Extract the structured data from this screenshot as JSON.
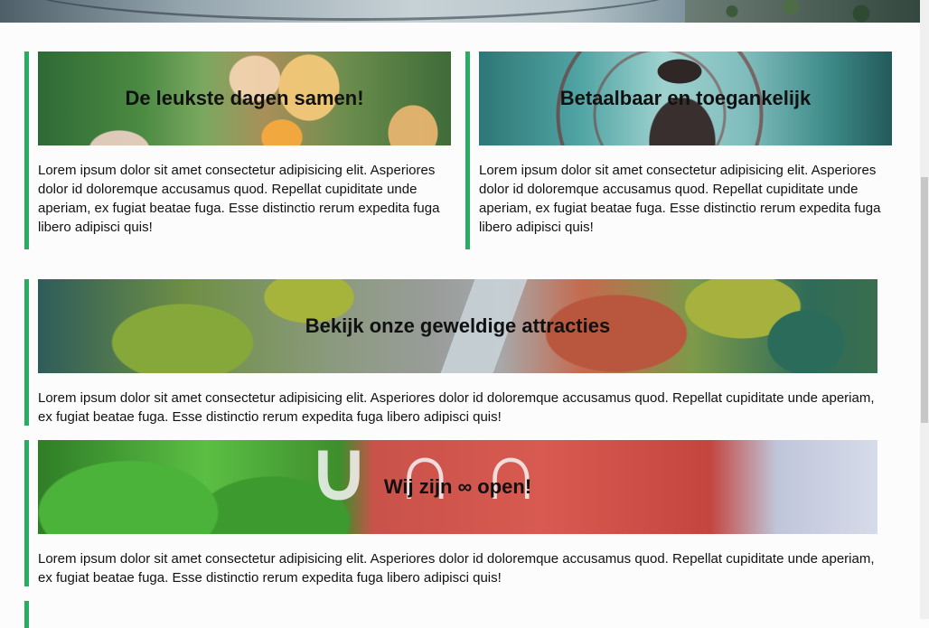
{
  "hero": {
    "image": "amusement-park-hero-image"
  },
  "cards": [
    {
      "title": "De leukste dagen samen!",
      "image": "family-photo",
      "text": "Lorem ipsum dolor sit amet consectetur adipisicing elit. Asperiores dolor id doloremque accusamus quod. Repellat cupiditate unde aperiam, ex fugiat beatae fuga. Esse distinctio rerum expedita fuga libero adipisci quis!"
    },
    {
      "title": "Betaalbaar en toegankelijk",
      "image": "ferris-wheel-photo",
      "text": "Lorem ipsum dolor sit amet consectetur adipisicing elit. Asperiores dolor id doloremque accusamus quod. Repellat cupiditate unde aperiam, ex fugiat beatae fuga. Esse distinctio rerum expedita fuga libero adipisci quis!"
    },
    {
      "title": "Bekijk onze geweldige attracties",
      "image": "aerial-park-photo",
      "text": "Lorem ipsum dolor sit amet consectetur adipisicing elit. Asperiores dolor id doloremque accusamus quod. Repellat cupiditate unde aperiam, ex fugiat beatae fuga. Esse distinctio rerum expedita fuga libero adipisci quis!"
    },
    {
      "title": "Wij zijn ∞ open!",
      "image": "open-sign-photo",
      "text": "Lorem ipsum dolor sit amet consectetur adipisicing elit. Asperiores dolor id doloremque accusamus quod. Repellat cupiditate unde aperiam, ex fugiat beatae fuga. Esse distinctio rerum expedita fuga libero adipisci quis!"
    }
  ],
  "colors": {
    "accent": "#27ae60",
    "background": "#fcfcfc",
    "text": "#111111"
  }
}
